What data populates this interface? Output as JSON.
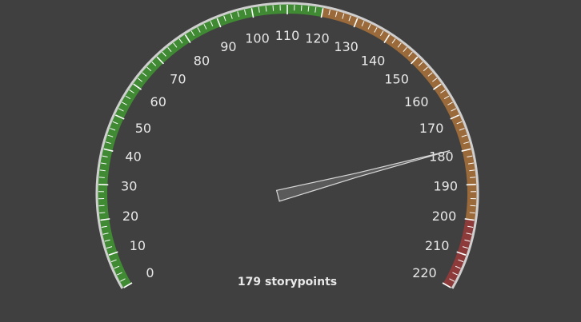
{
  "chart_data": {
    "type": "gauge",
    "min": 0,
    "max": 220,
    "major_step": 10,
    "minor_per_major": 5,
    "value": 179,
    "value_text": "179 storypoints",
    "tick_labels": [
      "0",
      "10",
      "20",
      "30",
      "40",
      "50",
      "60",
      "70",
      "80",
      "90",
      "100",
      "110",
      "120",
      "130",
      "140",
      "150",
      "160",
      "170",
      "180",
      "190",
      "200",
      "210",
      "220"
    ],
    "bands": [
      {
        "from": 0,
        "to": 120,
        "color": "#3f8a33"
      },
      {
        "from": 120,
        "to": 200,
        "color": "#9a6a3a"
      },
      {
        "from": 200,
        "to": 220,
        "color": "#8c3a3a"
      }
    ],
    "colors": {
      "background": "#404040",
      "rim": "#cfcfcf",
      "tick": "#ffffff",
      "label": "#e8e8e8",
      "needle_fill": "#5a5a5a",
      "needle_stroke": "#d8d8d8"
    }
  }
}
